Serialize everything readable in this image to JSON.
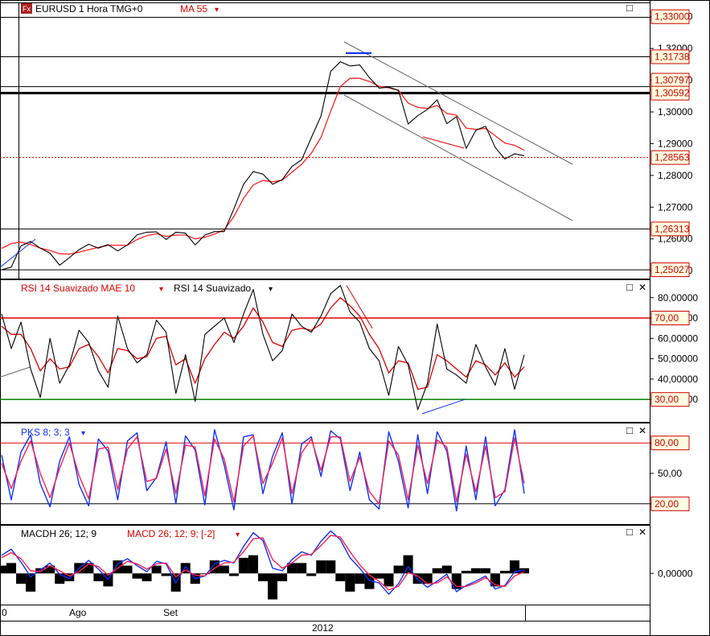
{
  "colors": {
    "price": "#000000",
    "ma": "#ff2020",
    "rsi_signal": "#e00000",
    "stoch_k": "#1030ff",
    "stoch_d": "#ff2050",
    "macd": "#1030ff",
    "macd_signal": "#ff2050",
    "level_red": "#e00000",
    "level_green": "#008000",
    "label_bg": "#ffffe0",
    "label_red": "#cc0000"
  },
  "icons": [
    "fx-logo-icon",
    "dropdown-arrow-icon",
    "maximize-icon",
    "close-icon"
  ],
  "chart_data": [
    {
      "type": "line",
      "panel": "price",
      "title": "EURUSD 1 Hora TMG+0",
      "overlay": "MA 55",
      "y_ticks": [
        "1,33000",
        "1,32000",
        "1,31000",
        "1,30000",
        "1,29000",
        "1,28000",
        "1,27000",
        "1,26000",
        "1,25000"
      ],
      "ylim": [
        1.2475,
        1.3345
      ],
      "price_labels": [
        "1,33000",
        "1,31738",
        "1,30797",
        "1,30592",
        "1,28563",
        "1,26313",
        "1,25027"
      ],
      "horizontal_lines": [
        1.31738,
        1.30797,
        1.30592,
        1.28563,
        1.26313,
        1.25027
      ],
      "current_price": 1.28563,
      "series": [
        {
          "values": [
            1.2503,
            1.2511,
            1.2578,
            1.2592,
            1.2571,
            1.2555,
            1.2517,
            1.2541,
            1.2566,
            1.2583,
            1.2571,
            1.2582,
            1.2562,
            1.2581,
            1.2613,
            1.2621,
            1.2622,
            1.2598,
            1.2621,
            1.2618,
            1.2581,
            1.2612,
            1.2623,
            1.2623,
            1.2695,
            1.2772,
            1.2812,
            1.2804,
            1.2772,
            1.2787,
            1.2828,
            1.2849,
            1.2919,
            1.2987,
            1.3128,
            1.3158,
            1.3145,
            1.3148,
            1.3108,
            1.3075,
            1.3078,
            1.3068,
            1.2962,
            1.2988,
            1.3008,
            1.3038,
            1.2963,
            1.2985,
            1.2885,
            1.2942,
            1.2955,
            1.2888,
            1.2852,
            1.2868,
            1.2862
          ]
        },
        {
          "values": [
            1.257,
            1.2585,
            1.259,
            1.2582,
            1.2571,
            1.2563,
            1.2553,
            1.2552,
            1.2558,
            1.2566,
            1.2573,
            1.258,
            1.258,
            1.258,
            1.2598,
            1.261,
            1.2616,
            1.2608,
            1.2612,
            1.2612,
            1.26,
            1.2605,
            1.2615,
            1.2629,
            1.267,
            1.2728,
            1.277,
            1.2784,
            1.278,
            1.2785,
            1.281,
            1.2835,
            1.287,
            1.292,
            1.3002,
            1.308,
            1.3106,
            1.3106,
            1.3096,
            1.3081,
            1.3076,
            1.3068,
            1.3028,
            1.3014,
            1.3011,
            1.302,
            1.2995,
            1.299,
            1.2949,
            1.2945,
            1.2948,
            1.2925,
            1.2902,
            1.2895,
            1.2879
          ]
        }
      ]
    },
    {
      "type": "line",
      "panel": "rsi",
      "labels": [
        "RSI 14 Suavizado MAE 10",
        "RSI 14 Suavizado"
      ],
      "y_ticks": [
        "80,00000",
        "70,00000",
        "60,00000",
        "50,00000",
        "40,00000",
        "30,00000"
      ],
      "ylim": [
        19,
        89
      ],
      "levels": [
        "70,00",
        "30,00"
      ],
      "series": [
        {
          "values": [
            72,
            55,
            68,
            45,
            31,
            60,
            38,
            47,
            64,
            58,
            44,
            36,
            71,
            55,
            48,
            52,
            69,
            63,
            33,
            52,
            29,
            62,
            66,
            70,
            58,
            72,
            84,
            62,
            49,
            54,
            72,
            66,
            63,
            71,
            82,
            86,
            73,
            68,
            55,
            49,
            32,
            56,
            47,
            25,
            38,
            67,
            45,
            42,
            38,
            57,
            46,
            37,
            55,
            35,
            52
          ]
        },
        {
          "values": [
            66,
            62,
            62,
            55,
            44,
            50,
            45,
            46,
            55,
            57,
            51,
            43,
            55,
            54,
            50,
            51,
            60,
            61,
            47,
            50,
            38,
            50,
            57,
            63,
            60,
            66,
            75,
            68,
            58,
            56,
            64,
            65,
            64,
            67,
            75,
            80,
            76,
            71,
            62,
            55,
            43,
            49,
            48,
            35,
            36,
            52,
            49,
            45,
            41,
            49,
            47,
            42,
            48,
            41,
            46
          ]
        }
      ]
    },
    {
      "type": "line",
      "panel": "stochastic",
      "label": "PKS 8; 3; 3",
      "y_ticks": [
        "80,00",
        "50,00",
        "20,00"
      ],
      "ylim": [
        0,
        100
      ],
      "levels": [
        "80,00",
        "20,00"
      ],
      "series": [
        {
          "values": [
            68,
            24,
            71,
            88,
            40,
            17,
            62,
            86,
            39,
            18,
            84,
            72,
            24,
            82,
            90,
            33,
            46,
            81,
            20,
            87,
            73,
            19,
            93,
            58,
            14,
            86,
            88,
            30,
            67,
            90,
            20,
            79,
            86,
            47,
            92,
            84,
            33,
            71,
            24,
            15,
            91,
            62,
            16,
            88,
            30,
            91,
            72,
            13,
            77,
            24,
            86,
            18,
            34,
            93,
            30
          ]
        },
        {
          "values": [
            60,
            35,
            62,
            82,
            50,
            26,
            55,
            80,
            48,
            25,
            74,
            76,
            34,
            74,
            86,
            42,
            45,
            74,
            30,
            78,
            76,
            28,
            84,
            64,
            22,
            77,
            87,
            40,
            60,
            85,
            30,
            70,
            84,
            53,
            86,
            86,
            42,
            66,
            32,
            20,
            82,
            68,
            24,
            78,
            40,
            83,
            76,
            22,
            69,
            32,
            77,
            26,
            32,
            85,
            40
          ]
        }
      ]
    },
    {
      "type": "line",
      "panel": "macd",
      "labels": [
        "MACDH 26; 12; 9",
        "MACD 26; 12; 9; [-2]"
      ],
      "y_ticks": [
        "0,00000"
      ],
      "ylim": [
        -0.0036,
        0.0056
      ],
      "series": [
        {
          "values": [
            0.0021,
            0.0028,
            0.0013,
            -0.0004,
            0.0004,
            0.0012,
            -0.0001,
            -0.0006,
            0.0006,
            0.0015,
            0.0005,
            -0.0007,
            0.0011,
            0.0017,
            0.0009,
            0.0002,
            0.0014,
            0.0011,
            -0.0011,
            0.0008,
            -0.0006,
            -0.0003,
            0.0011,
            0.0015,
            0.0012,
            0.0031,
            0.0047,
            0.0038,
            0.0006,
            0.0003,
            0.0016,
            0.0025,
            0.0021,
            0.0037,
            0.0049,
            0.0039,
            0.0018,
            0.0006,
            -0.0008,
            -0.0011,
            -0.0024,
            -0.0012,
            0.0008,
            -0.0007,
            -0.0016,
            -0.0009,
            -0.0001,
            -0.0021,
            -0.0014,
            -0.0009,
            -0.0003,
            -0.0018,
            -0.0014,
            0.0002,
            0.0004
          ]
        },
        {
          "values": [
            0.0018,
            0.0024,
            0.0017,
            0.0003,
            0.0002,
            0.0009,
            0.0003,
            -0.0003,
            0.0002,
            0.0011,
            0.0008,
            -0.0002,
            0.0006,
            0.0014,
            0.0011,
            0.0005,
            0.0011,
            0.0012,
            -0.0004,
            0.0004,
            -0.0002,
            -0.0003,
            0.0006,
            0.0012,
            0.0013,
            0.0025,
            0.004,
            0.0041,
            0.0016,
            0.0006,
            0.0012,
            0.0021,
            0.0022,
            0.0032,
            0.0044,
            0.0042,
            0.0025,
            0.001,
            -0.0002,
            -0.0009,
            -0.0019,
            -0.0015,
            0.0001,
            -0.0003,
            -0.0012,
            -0.0011,
            -0.0004,
            -0.0015,
            -0.0015,
            -0.0011,
            -0.0005,
            -0.0013,
            -0.0015,
            -0.0003,
            0.0002
          ]
        }
      ]
    }
  ],
  "x_axis": {
    "labels": [
      "0",
      "Ago",
      "Set"
    ],
    "year": "2012"
  },
  "controls": {
    "arrow": "▾",
    "maximize": "□",
    "close": "✕",
    "logo": "Fx"
  }
}
